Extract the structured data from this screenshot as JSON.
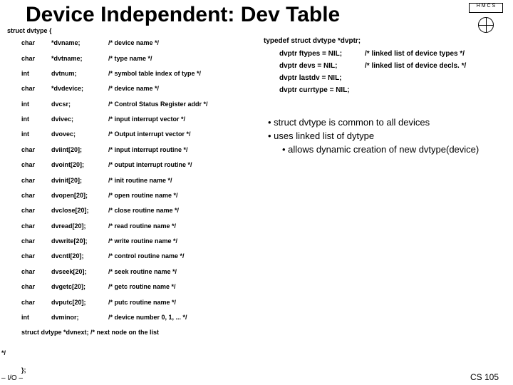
{
  "title": "Device Independent:  Dev Table",
  "struct_open": "struct  dvtype {",
  "rows": [
    {
      "t": "char",
      "n": "*dvname;",
      "c": "/* device name */"
    },
    {
      "t": "char",
      "n": "*dvtname;",
      "c": "/* type name                              */"
    },
    {
      "t": "int",
      "n": "dvtnum;",
      "c": "/* symbol table index of type  */"
    },
    {
      "t": "char",
      "n": "*dvdevice;",
      "c": "/* device name                           */"
    },
    {
      "t": "int",
      "n": "dvcsr;",
      "c": "/* Control Status Register addr */"
    },
    {
      "t": "int",
      "n": "dvivec;",
      "c": "/* input interrupt vector           */"
    },
    {
      "t": "int",
      "n": "dvovec;",
      "c": "/* Output interrupt vector         */"
    },
    {
      "t": "char",
      "n": "dviint[20];",
      "c": "/* input interrupt routine          */"
    },
    {
      "t": "char",
      "n": "dvoint[20];",
      "c": "/* output interrupt routine        */"
    },
    {
      "t": "char",
      "n": "dvinit[20];",
      "c": "/* init routine name                  */"
    },
    {
      "t": "char",
      "n": "dvopen[20];",
      "c": "/* open routine name                */"
    },
    {
      "t": "char",
      "n": "dvclose[20];",
      "c": "/* close routine name               */"
    },
    {
      "t": "char",
      "n": "dvread[20];",
      "c": "/* read routine name                */"
    },
    {
      "t": "char",
      "n": "dvwrite[20];",
      "c": "/* write routine name               */"
    },
    {
      "t": "char",
      "n": "dvcntl[20];",
      "c": "/* control routine name            */"
    },
    {
      "t": "char",
      "n": "dvseek[20];",
      "c": "/* seek routine name                */"
    },
    {
      "t": "char",
      "n": "dvgetc[20];",
      "c": "/* getc routine name                */"
    },
    {
      "t": "char",
      "n": "dvputc[20];",
      "c": "/* putc routine name                */"
    },
    {
      "t": "int",
      "n": "dvminor;",
      "c": "/* device number 0, 1, ...           */"
    }
  ],
  "struct_next": "struct dvtype   *dvnext;        /* next node on the list",
  "struct_close": "};",
  "endcomment": "*/",
  "io": "– I/O –",
  "cs": "CS 105",
  "typedef": "typedef struct  dvtype  *dvptr;",
  "trows": [
    {
      "l": "dvptr   ftypes = NIL;",
      "r": "/* linked list of device types  */"
    },
    {
      "l": "dvptr   devs = NIL;",
      "r": "/* linked list of device decls. */"
    },
    {
      "l": "dvptr   lastdv = NIL;",
      "r": ""
    },
    {
      "l": "dvptr   currtype = NIL;",
      "r": ""
    }
  ],
  "bullets": {
    "b1": "• struct dvtype is common to all devices",
    "b2": "• uses linked list of dytype",
    "b3": "• allows dynamic creation of new dvtype(device)"
  },
  "logo": "H M C S"
}
